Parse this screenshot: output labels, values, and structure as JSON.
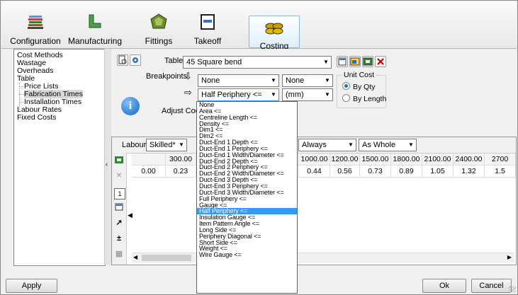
{
  "toolbar": {
    "tabs": [
      {
        "label": "Configuration",
        "icon": "books-icon"
      },
      {
        "label": "Manufacturing",
        "icon": "pipe-icon"
      },
      {
        "label": "Fittings",
        "icon": "fitting-icon"
      },
      {
        "label": "Takeoff",
        "icon": "takeoff-icon"
      },
      {
        "label": "Costing",
        "icon": "coins-icon",
        "active": true
      }
    ]
  },
  "tree": {
    "items": [
      {
        "label": "Cost Methods"
      },
      {
        "label": "Wastage"
      },
      {
        "label": "Overheads"
      },
      {
        "label": "Table"
      },
      {
        "label": "Price Lists"
      },
      {
        "label": "Fabrication Times"
      },
      {
        "label": "Installation Times"
      },
      {
        "label": "Labour Rates"
      },
      {
        "label": "Fixed Costs"
      }
    ]
  },
  "form": {
    "table_label": "Table",
    "table_value": "45 Square bend",
    "breakpoints_label": "Breakpoints",
    "bp1_value": "None",
    "bp1_unit": "None",
    "bp2_value": "Half Periphery <=",
    "bp2_unit": "(mm)",
    "adjust_code_label": "Adjust Code",
    "unit_cost_label": "Unit Cost",
    "radio_by_qty": "By Qty",
    "radio_by_length": "By Length"
  },
  "grid": {
    "labour_label": "Labour",
    "labour_value": "Skilled*",
    "always_value": "Always",
    "whole_value": "As Whole",
    "col_headers": [
      "300.00",
      "1000.00",
      "1200.00",
      "1500.00",
      "1800.00",
      "2100.00",
      "2400.00",
      "2700"
    ],
    "row_header": "0.00",
    "row_values": [
      "0.23",
      "0.44",
      "0.56",
      "0.73",
      "0.89",
      "1.05",
      "1.32",
      "1.5"
    ]
  },
  "dropdown": {
    "options": [
      "None",
      "Area <=",
      "Centreline Length <=",
      "Density <=",
      "Dim1 <=",
      "Dim2 <=",
      "Duct-End 1 Depth <=",
      "Duct-End 1 Periphery <=",
      "Duct-End 1 Width/Diameter <=",
      "Duct-End 2 Depth <=",
      "Duct-End 2 Periphery <=",
      "Duct-End 2 Width/Diameter <=",
      "Duct-End 3 Depth <=",
      "Duct-End 3 Periphery <=",
      "Duct-End 3 Width/Diameter <=",
      "Full Periphery <=",
      "Gauge <=",
      "Half Periphery <=",
      "Insulation Gauge <=",
      "Item Pattern Angle <=",
      "Long Side <=",
      "Periphery Diagonal <=",
      "Short Side <=",
      "Weight <=",
      "Wire Gauge <="
    ],
    "selected": "Half Periphery <="
  },
  "buttons": {
    "apply": "Apply",
    "ok": "Ok",
    "cancel": "Cancel"
  },
  "colors": {
    "selection": "#3399ff",
    "accent": "#1565c0"
  }
}
